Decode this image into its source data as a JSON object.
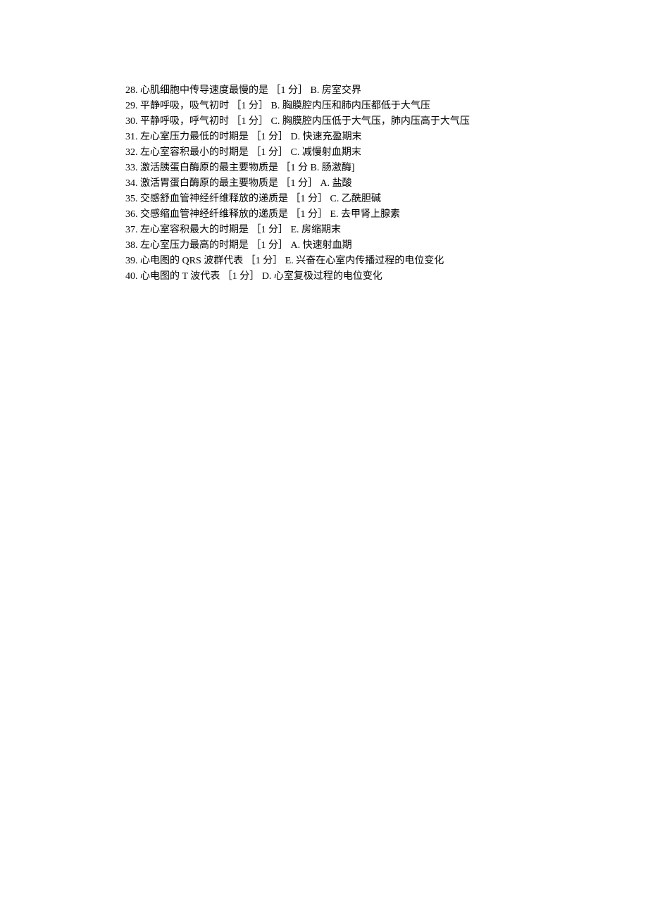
{
  "items": [
    {
      "num": "28.",
      "question": "心肌细胞中传导速度最慢的是",
      "score": "［1 分］",
      "answer": "B. 房室交界"
    },
    {
      "num": "29.",
      "question": "平静呼吸，吸气初时",
      "score": "［1 分］",
      "answer": "B. 胸膜腔内压和肺内压都低于大气压"
    },
    {
      "num": "30.",
      "question": "平静呼吸，呼气初时",
      "score": "［1 分］",
      "answer": "C. 胸膜腔内压低于大气压，肺内压高于大气压"
    },
    {
      "num": "31.",
      "question": "左心室压力最低的时期是",
      "score": "［1 分］",
      "answer": "D. 快速充盈期末"
    },
    {
      "num": "32.",
      "question": "左心室容积最小的时期是",
      "score": "［1 分］",
      "answer": "C. 减慢射血期末"
    },
    {
      "num": "33.",
      "question": "激活胰蛋白酶原的最主要物质是",
      "score": "［1 分",
      "answer": "B. 肠激酶]"
    },
    {
      "num": "34.",
      "question": "激活胃蛋白酶原的最主要物质是",
      "score": "［1 分］",
      "answer": "A. 盐酸"
    },
    {
      "num": "35.",
      "question": "交感舒血管神经纤维释放的递质是",
      "score": "［1 分］",
      "answer": "C. 乙酰胆碱"
    },
    {
      "num": "36.",
      "question": "交感缩血管神经纤维释放的递质是",
      "score": "［1 分］",
      "answer": "E. 去甲肾上腺素"
    },
    {
      "num": "37.",
      "question": "左心室容积最大的时期是",
      "score": "［1 分］",
      "answer": "E. 房缩期末"
    },
    {
      "num": "38.",
      "question": "左心室压力最高的时期是",
      "score": "［1 分］",
      "answer": "A. 快速射血期"
    },
    {
      "num": "39.",
      "question": "心电图的 QRS 波群代表",
      "score": "［1 分］",
      "answer": "E. 兴奋在心室内传播过程的电位变化"
    },
    {
      "num": "40.",
      "question": "心电图的 T 波代表",
      "score": "［1 分］",
      "answer": "D. 心室复极过程的电位变化"
    }
  ]
}
